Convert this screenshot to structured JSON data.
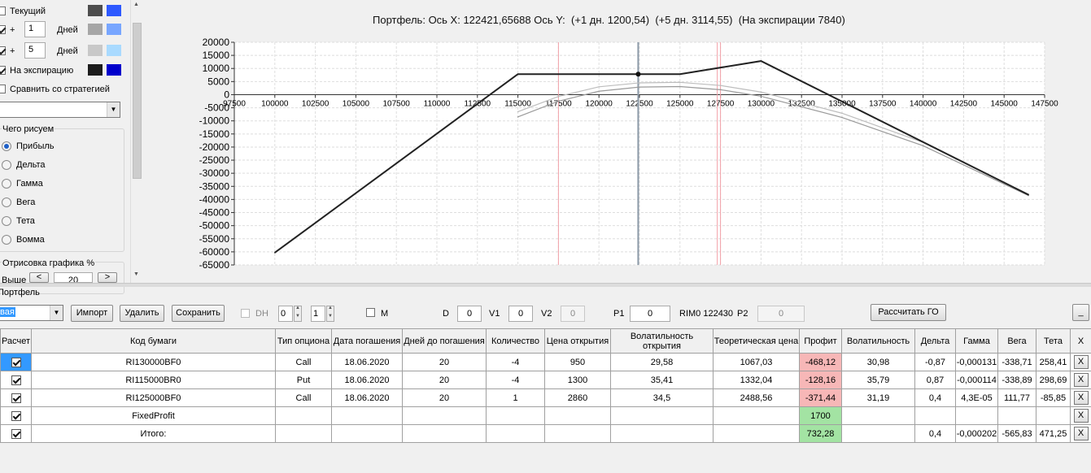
{
  "left": {
    "current_label": "Текущий",
    "plus1": {
      "sign": "+",
      "value": "1",
      "unit": "Дней"
    },
    "plus5": {
      "sign": "+",
      "value": "5",
      "unit": "Дней"
    },
    "expiry_label": "На экспирацию",
    "compare_label": "Сравнить со стратегией",
    "compare_select": "",
    "what_draw": {
      "title": "Чего рисуем",
      "options": [
        "Прибыль",
        "Дельта",
        "Гамма",
        "Вега",
        "Тета",
        "Вомма"
      ],
      "selected": "Прибыль"
    },
    "draw_pct": {
      "title": "Отрисовка графика %",
      "higher_label": "Выше",
      "value": "20"
    },
    "colors": {
      "current": [
        "#4d4d4d",
        "#2e59ff"
      ],
      "plus1": [
        "#a6a6a6",
        "#78a6ff"
      ],
      "plus5": [
        "#c8c8c8",
        "#a9daff"
      ],
      "expiry": [
        "#1c1c1c",
        "#0000cc"
      ]
    }
  },
  "chart": {
    "title_prefix": "Портфель:",
    "title_x": "Ось X: 122421,65688",
    "title_y": "Ось Y:",
    "title_p1": "(+1 дн. 1200,54)",
    "title_p5": "(+5 дн. 3114,55)",
    "title_exp": "(На экспирации 7840)"
  },
  "chart_data": {
    "type": "line",
    "title": "Портфель: Ось X: 122421,65688 Ось Y: (+1 дн. 1200,54) (+5 дн. 3114,55) (На экспирации 7840)",
    "xlim": [
      97500,
      147500
    ],
    "ylim": [
      -65000,
      20000
    ],
    "x_ticks": [
      97500,
      100000,
      102500,
      105000,
      107500,
      110000,
      112500,
      115000,
      117500,
      120000,
      122500,
      125000,
      127500,
      130000,
      132500,
      135000,
      137500,
      140000,
      142500,
      145000,
      147500
    ],
    "y_ticks": [
      20000,
      15000,
      10000,
      5000,
      0,
      -5000,
      -10000,
      -15000,
      -20000,
      -25000,
      -30000,
      -35000,
      -40000,
      -45000,
      -50000,
      -55000,
      -60000,
      -65000
    ],
    "grid": true,
    "series": [
      {
        "color": "#222222",
        "x": [
          100000,
          115000,
          125000,
          130000,
          146500
        ],
        "y": [
          -60300,
          7840,
          7840,
          12840,
          -38200
        ]
      },
      {
        "color": "#9a9a9a",
        "x": [
          115000,
          117500,
          120000,
          122500,
          125000,
          127500,
          130000,
          135000,
          140000,
          146500
        ],
        "y": [
          -8500,
          -2500,
          1300,
          2900,
          3100,
          1900,
          -600,
          -8700,
          -19500,
          -38500
        ]
      },
      {
        "color": "#bdbdbd",
        "x": [
          115000,
          117500,
          120000,
          122500,
          125000,
          127500,
          130000,
          135000,
          140000,
          146500
        ],
        "y": [
          -6500,
          -700,
          3000,
          4500,
          4700,
          3500,
          1000,
          -7100,
          -18200,
          -38000
        ]
      }
    ],
    "markers": [
      {
        "x": 122421.65688,
        "y": 7840
      }
    ],
    "vlines": [
      {
        "x": 122421.65688,
        "color": "#8c9aa8"
      },
      {
        "x": 117500,
        "color": "#f2a0a8"
      },
      {
        "x": 127300,
        "color": "#f2a0a8"
      },
      {
        "x": 127500,
        "color": "#f2a0a8"
      }
    ]
  },
  "toolbar": {
    "portfolio_label": "Портфель",
    "portfolio_select": "вая",
    "import": "Импорт",
    "delete": "Удалить",
    "save": "Сохранить",
    "dh_label": "DH",
    "spin1": "0",
    "spin2": "1",
    "m_label": "M",
    "d_label": "D",
    "d_value": "0",
    "v1_label": "V1",
    "v1_value": "0",
    "v2_label": "V2",
    "v2_value": "0",
    "p1_label": "P1",
    "p1_value": "0",
    "rim_label": "RIM0 122430",
    "p2_label": "P2",
    "p2_value": "0",
    "calc_go": "Рассчитать ГО",
    "minimize": "_"
  },
  "table": {
    "headers": [
      "Расчет",
      "Код бумаги",
      "Тип опциона",
      "Дата погашения",
      "Дней до погашения",
      "Количество",
      "Цена открытия",
      "Волатильность открытия",
      "Теоретическая цена",
      "Профит",
      "Волатильность",
      "Дельта",
      "Гамма",
      "Вега",
      "Тета",
      "X"
    ],
    "rows": [
      {
        "code": "RI130000BF0",
        "type": "Call",
        "date": "18.06.2020",
        "days": "20",
        "qty": "-4",
        "price": "950",
        "vol_open": "29,58",
        "theo": "1067,03",
        "profit": "-468,12",
        "vol": "30,98",
        "delta": "-0,87",
        "gamma": "-0,000131",
        "vega": "-338,71",
        "theta": "258,41",
        "x": "X"
      },
      {
        "code": "RI115000BR0",
        "type": "Put",
        "date": "18.06.2020",
        "days": "20",
        "qty": "-4",
        "price": "1300",
        "vol_open": "35,41",
        "theo": "1332,04",
        "profit": "-128,16",
        "vol": "35,79",
        "delta": "0,87",
        "gamma": "-0,000114",
        "vega": "-338,89",
        "theta": "298,69",
        "x": "X"
      },
      {
        "code": "RI125000BF0",
        "type": "Call",
        "date": "18.06.2020",
        "days": "20",
        "qty": "1",
        "price": "2860",
        "vol_open": "34,5",
        "theo": "2488,56",
        "profit": "-371,44",
        "vol": "31,19",
        "delta": "0,4",
        "gamma": "4,3E-05",
        "vega": "111,77",
        "theta": "-85,85",
        "x": "X"
      },
      {
        "code": "FixedProfit",
        "profit": "1700",
        "x": "X"
      },
      {
        "code": "Итого:",
        "profit": "732,28",
        "delta": "0,4",
        "gamma": "-0,000202",
        "vega": "-565,83",
        "theta": "471,25",
        "x": "X"
      }
    ]
  }
}
